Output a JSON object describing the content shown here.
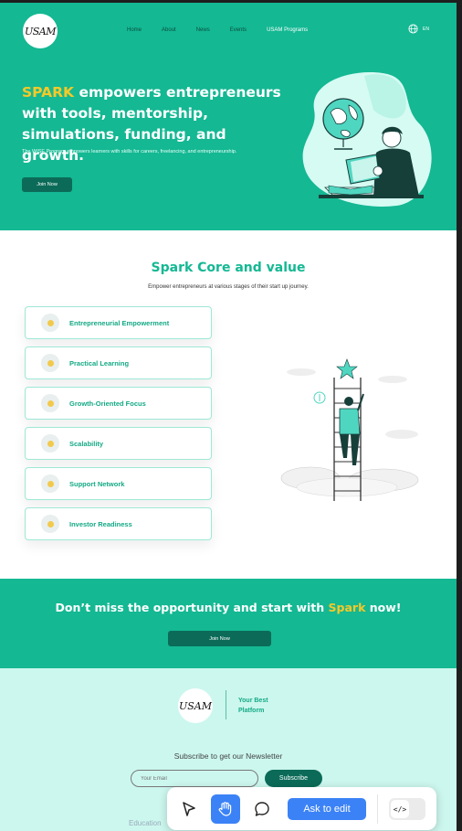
{
  "brand": {
    "logo_text": "USAM"
  },
  "nav": {
    "items": [
      {
        "label": "Home"
      },
      {
        "label": "About"
      },
      {
        "label": "News"
      },
      {
        "label": "Events"
      },
      {
        "label": "USAM Programs"
      }
    ],
    "lang": "EN"
  },
  "hero": {
    "title_accent": "SPARK",
    "title_rest": " empowers entrepreneurs with tools, mentorship, simulations, funding, and growth.",
    "subtitle": "The WISE Program empowers learners with skills for careers, freelancing, and entrepreneurship.",
    "button": "Join Now"
  },
  "core": {
    "title": "Spark Core and value",
    "subtitle": "Empower entrepreneurs at various stages of their start up journey.",
    "values": [
      {
        "label": "Entrepreneurial Empowerment"
      },
      {
        "label": "Practical Learning"
      },
      {
        "label": "Growth-Oriented Focus"
      },
      {
        "label": "Scalability"
      },
      {
        "label": "Support Network"
      },
      {
        "label": "Investor Readiness"
      }
    ]
  },
  "cta": {
    "title_before": "Don’t miss the opportunity and start with ",
    "title_accent": "Spark",
    "title_after": " now!",
    "button": "Join Now"
  },
  "footer": {
    "tagline_line1": "Your Best",
    "tagline_line2": "Platform",
    "newsletter_title": "Subscribe to get our Newsletter",
    "email_placeholder": "Your Email",
    "subscribe_button": "Subscribe",
    "bottom_text": "Education"
  },
  "toolbar": {
    "ask_label": "Ask to edit",
    "active_tool": "hand"
  },
  "colors": {
    "primary": "#14b893",
    "accent": "#f6c928",
    "dark_button": "#0b6b58",
    "footer_bg": "#ccf7ee",
    "toolbar_blue": "#3b82f6"
  }
}
